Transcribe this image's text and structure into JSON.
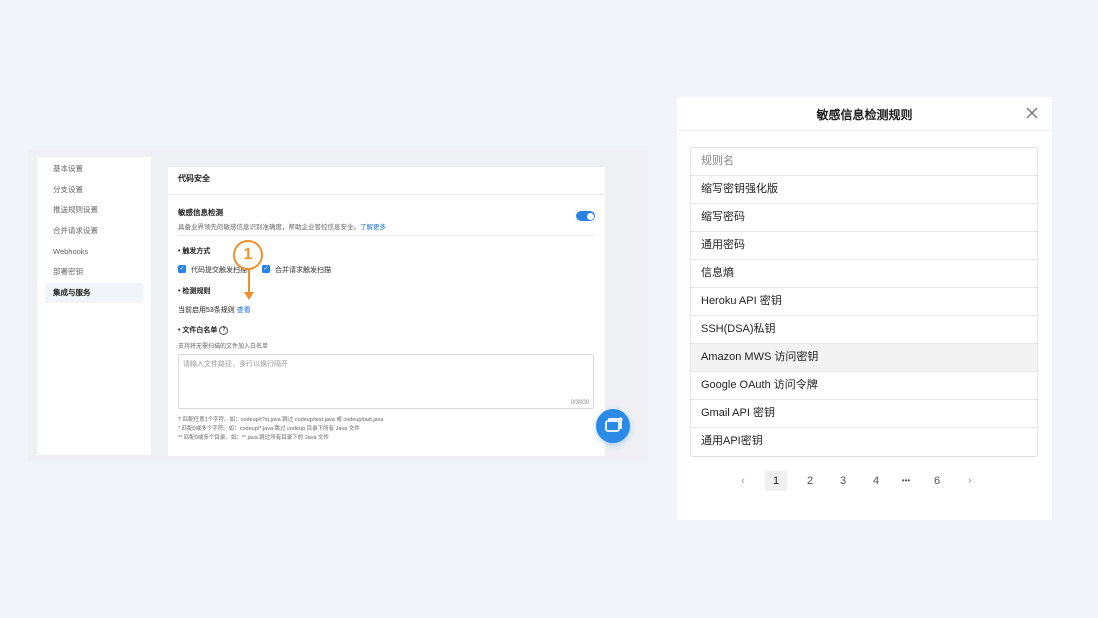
{
  "left": {
    "sidebar_items": [
      "基本设置",
      "分支设置",
      "推送规则设置",
      "合并请求设置",
      "Webhooks",
      "部署密钥",
      "集成与服务"
    ],
    "section_title": "代码安全",
    "sensitive_title": "敏感信息检测",
    "sensitive_desc": "具备业界领先的敏感信息识别准确度，帮助企业管控信息安全。",
    "learn_more": "了解更多",
    "trigger_title": "• 触发方式",
    "trigger_commit": "代码提交触发扫描",
    "trigger_mr": "合并请求触发扫描",
    "rules_title": "• 检测规则",
    "rules_current": "当前启用53条规则",
    "rules_view": "查看",
    "whitelist_title": "• 文件白名单",
    "whitelist_desc": "支持将无需扫描的文件加入白名单",
    "textarea_placeholder": "请输入文件路径，多行以换行隔开",
    "textarea_count": "0/3000",
    "hints": [
      "?   匹配任意1个字符。如：codeup/t?st.java 跳过 codeup/test.java 或 codeup/tast.java",
      "*   匹配0或多个字符。如：codeup/*.java 跳过 codeup 目录下所有 Java 文件",
      "**  匹配0或多个目录。如：**.java 跳过所有目录下的 Java 文件"
    ],
    "annotation_number": "1"
  },
  "dialog": {
    "title": "敏感信息检测规则",
    "column_header": "规则名",
    "rows": [
      "缩写密钥强化版",
      "缩写密码",
      "通用密码",
      "信息熵",
      "Heroku API 密钥",
      "SSH(DSA)私钥",
      "Amazon MWS 访问密钥",
      "Google OAuth 访问令牌",
      "Gmail API 密钥",
      "通用API密钥"
    ],
    "pagination": {
      "prev": "‹",
      "pages": [
        "1",
        "2",
        "3",
        "4",
        "•••",
        "6"
      ],
      "next": "›",
      "current": "1"
    }
  },
  "colors": {
    "accent": "#2a82e4",
    "annotation": "#f0902a",
    "background": "#f1f5fa"
  }
}
